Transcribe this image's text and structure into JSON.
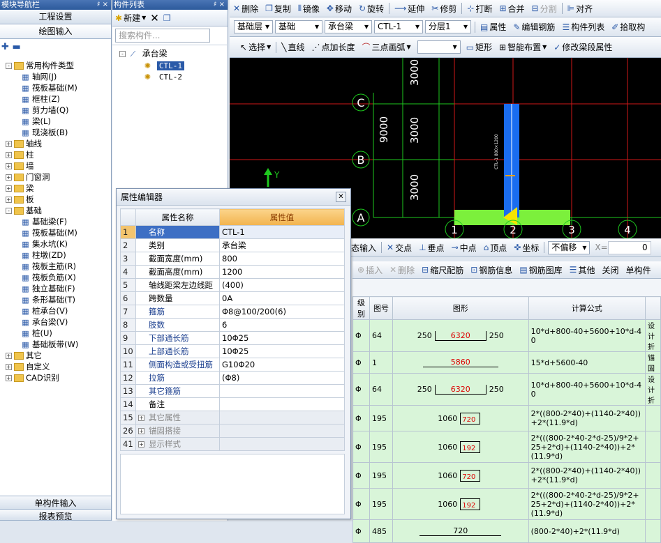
{
  "nav": {
    "title": "模块导航栏",
    "pin": "♯ ×",
    "btn_settings": "工程设置",
    "btn_draw": "绘图输入",
    "tree": [
      {
        "label": "常用构件类型",
        "type": "folder",
        "level": 0,
        "exp": "-"
      },
      {
        "label": "轴网(J)",
        "type": "item",
        "level": 1,
        "icon": "grid-icon"
      },
      {
        "label": "筏板基础(M)",
        "type": "item",
        "level": 1,
        "icon": "raft-icon"
      },
      {
        "label": "框柱(Z)",
        "type": "item",
        "level": 1,
        "icon": "column-icon"
      },
      {
        "label": "剪力墙(Q)",
        "type": "item",
        "level": 1,
        "icon": "wall-icon"
      },
      {
        "label": "梁(L)",
        "type": "item",
        "level": 1,
        "icon": "beam-icon"
      },
      {
        "label": "现浇板(B)",
        "type": "item",
        "level": 1,
        "icon": "slab-icon"
      },
      {
        "label": "轴线",
        "type": "folder",
        "level": 0,
        "exp": "+"
      },
      {
        "label": "柱",
        "type": "folder",
        "level": 0,
        "exp": "+"
      },
      {
        "label": "墙",
        "type": "folder",
        "level": 0,
        "exp": "+"
      },
      {
        "label": "门窗洞",
        "type": "folder",
        "level": 0,
        "exp": "+"
      },
      {
        "label": "梁",
        "type": "folder",
        "level": 0,
        "exp": "+"
      },
      {
        "label": "板",
        "type": "folder",
        "level": 0,
        "exp": "+"
      },
      {
        "label": "基础",
        "type": "folder",
        "level": 0,
        "exp": "-"
      },
      {
        "label": "基础梁(F)",
        "type": "item",
        "level": 1,
        "icon": "foundation-beam-icon"
      },
      {
        "label": "筏板基础(M)",
        "type": "item",
        "level": 1,
        "icon": "raft-icon"
      },
      {
        "label": "集水坑(K)",
        "type": "item",
        "level": 1,
        "icon": "sump-icon"
      },
      {
        "label": "柱墩(ZD)",
        "type": "item",
        "level": 1,
        "icon": "pier-icon"
      },
      {
        "label": "筏板主筋(R)",
        "type": "item",
        "level": 1,
        "icon": "rebar-icon"
      },
      {
        "label": "筏板负筋(X)",
        "type": "item",
        "level": 1,
        "icon": "rebar-icon"
      },
      {
        "label": "独立基础(F)",
        "type": "item",
        "level": 1,
        "icon": "footing-icon"
      },
      {
        "label": "条形基础(T)",
        "type": "item",
        "level": 1,
        "icon": "strip-icon"
      },
      {
        "label": "桩承台(V)",
        "type": "item",
        "level": 1,
        "icon": "pile-cap-icon"
      },
      {
        "label": "承台梁(V)",
        "type": "item",
        "level": 1,
        "icon": "cap-beam-icon"
      },
      {
        "label": "桩(U)",
        "type": "item",
        "level": 1,
        "icon": "pile-icon"
      },
      {
        "label": "基础板带(W)",
        "type": "item",
        "level": 1,
        "icon": "band-icon"
      },
      {
        "label": "其它",
        "type": "folder",
        "level": 0,
        "exp": "+"
      },
      {
        "label": "自定义",
        "type": "folder",
        "level": 0,
        "exp": "+"
      },
      {
        "label": "CAD识别",
        "type": "folder",
        "level": 0,
        "exp": "+"
      }
    ],
    "btn_single": "单构件输入",
    "btn_report": "报表预览"
  },
  "clist": {
    "title": "构件列表",
    "new_label": "新建",
    "search_placeholder": "搜索构件...",
    "root": "承台梁",
    "items": [
      "CTL-1",
      "CTL-2"
    ]
  },
  "toolbar1": [
    "删除",
    "复制",
    "镜像",
    "移动",
    "旋转",
    "延伸",
    "修剪",
    "打断",
    "合并",
    "分割",
    "对齐"
  ],
  "toolbar2": {
    "floor": "基础层",
    "category": "基础",
    "type": "承台梁",
    "name": "CTL-1",
    "layer": "分层1",
    "buttons": [
      "属性",
      "编辑钢筋",
      "构件列表",
      "拾取构"
    ]
  },
  "toolbar3": [
    "选择",
    "直线",
    "点加长度",
    "三点画弧",
    "矩形",
    "智能布置",
    "修改梁段属性"
  ],
  "canvas": {
    "dims": [
      "3000",
      "3000",
      "3000",
      "9000"
    ],
    "axes_rows": [
      "C",
      "B",
      "A"
    ],
    "axes_cols": [
      "1",
      "2",
      "3",
      "4"
    ],
    "y_label": "Y",
    "beam_text": "CTL-1 800×1200"
  },
  "snapbar": {
    "items": [
      "态输入",
      "交点",
      "垂点",
      "中点",
      "顶点",
      "坐标"
    ],
    "offset": "不偏移",
    "x_label": "X=",
    "x_value": "0"
  },
  "propeditor": {
    "title": "属性编辑器",
    "col_name": "属性名称",
    "col_value": "属性值",
    "rows": [
      {
        "n": "1",
        "name": "名称",
        "value": "CTL-1",
        "style": "cur"
      },
      {
        "n": "2",
        "name": "类别",
        "value": "承台梁",
        "style": "blk"
      },
      {
        "n": "3",
        "name": "截面宽度(mm)",
        "value": "800",
        "style": "blk"
      },
      {
        "n": "4",
        "name": "截面高度(mm)",
        "value": "1200",
        "style": "blk"
      },
      {
        "n": "5",
        "name": "轴线距梁左边线距",
        "value": "(400)",
        "style": "blk"
      },
      {
        "n": "6",
        "name": "跨数量",
        "value": "0A",
        "style": "blk"
      },
      {
        "n": "7",
        "name": "箍筋",
        "value": "Φ8@100/200(6)",
        "style": ""
      },
      {
        "n": "8",
        "name": "肢数",
        "value": "6",
        "style": ""
      },
      {
        "n": "9",
        "name": "下部通长筋",
        "value": "10Φ25",
        "style": ""
      },
      {
        "n": "10",
        "name": "上部通长筋",
        "value": "10Φ25",
        "style": ""
      },
      {
        "n": "11",
        "name": "侧面构造或受扭筋",
        "value": "G10Φ20",
        "style": ""
      },
      {
        "n": "12",
        "name": "拉筋",
        "value": "(Φ8)",
        "style": ""
      },
      {
        "n": "13",
        "name": "其它箍筋",
        "value": "",
        "style": ""
      },
      {
        "n": "14",
        "name": "备注",
        "value": "",
        "style": "blk"
      },
      {
        "n": "15",
        "name": "其它属性",
        "value": "",
        "style": "gry",
        "exp": "+"
      },
      {
        "n": "26",
        "name": "锚固搭接",
        "value": "",
        "style": "gry",
        "exp": "+"
      },
      {
        "n": "41",
        "name": "显示样式",
        "value": "",
        "style": "gry",
        "exp": "+"
      }
    ]
  },
  "rebar": {
    "toolbar": [
      "插入",
      "删除",
      "缩尺配筋",
      "钢筋信息",
      "钢筋图库",
      "其他",
      "关闭",
      "单构件"
    ],
    "headers": [
      "级别",
      "图号",
      "图形",
      "计算公式",
      ""
    ],
    "rows": [
      {
        "grade": "Φ",
        "fig": "64",
        "shape": "6320",
        "left": "250",
        "right": "250",
        "formula": "10*d+800-40+5600+10*d-40",
        "extra": "设计折"
      },
      {
        "grade": "Φ",
        "fig": "1",
        "shape": "5860",
        "left": "",
        "right": "",
        "formula": "15*d+5600-40",
        "extra": "锚固"
      },
      {
        "grade": "Φ",
        "fig": "64",
        "shape": "6320",
        "left": "250",
        "right": "250",
        "formula": "10*d+800-40+5600+10*d-40",
        "extra": "设计折"
      },
      {
        "grade": "Φ",
        "fig": "195",
        "shape": "720",
        "left": "1060",
        "right": "",
        "formula": "2*((800-2*40)+(1140-2*40))+2*(11.9*d)",
        "extra": ""
      },
      {
        "grade": "Φ",
        "fig": "195",
        "shape": "192",
        "left": "1060",
        "right": "",
        "formula": "2*(((800-2*40-2*d-25)/9*2+25+2*d)+(1140-2*40))+2*(11.9*d)",
        "extra": ""
      },
      {
        "grade": "Φ",
        "fig": "195",
        "shape": "720",
        "left": "1060",
        "right": "",
        "formula": "2*((800-2*40)+(1140-2*40))+2*(11.9*d)",
        "extra": ""
      },
      {
        "grade": "Φ",
        "fig": "195",
        "shape": "192",
        "left": "1060",
        "right": "",
        "formula": "2*(((800-2*40-2*d-25)/9*2+25+2*d)+(1140-2*40))+2*(11.9*d)",
        "extra": ""
      },
      {
        "grade": "Φ",
        "fig": "485",
        "shape": "720",
        "left": "",
        "right": "",
        "formula": "(800-2*40)+2*(11.9*d)",
        "extra": ""
      }
    ]
  }
}
